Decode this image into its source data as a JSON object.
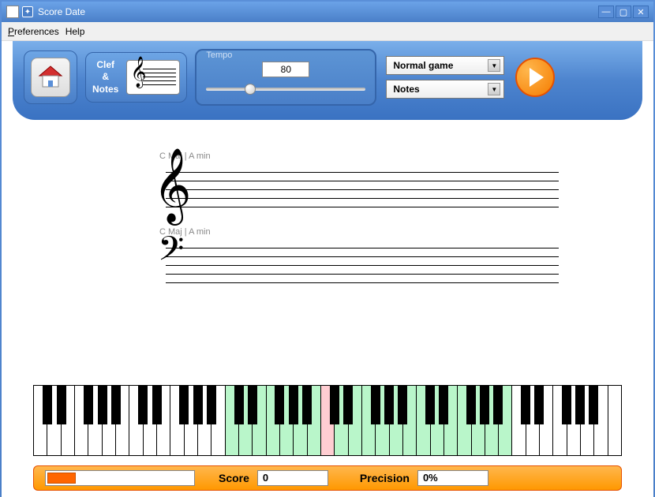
{
  "window": {
    "title": "Score Date"
  },
  "menubar": {
    "preferences": "Preferences",
    "help": "Help"
  },
  "toolbar": {
    "clef_notes_line1": "Clef",
    "clef_notes_line2": "&",
    "clef_notes_line3": "Notes",
    "tempo_label": "Tempo",
    "tempo_value": "80",
    "game_mode": "Normal game",
    "notes_mode": "Notes"
  },
  "staff": {
    "key1": "C Maj | A min",
    "key2": "C Maj | A min"
  },
  "keyboard": {
    "white_key_colors": [
      "w",
      "w",
      "w",
      "w",
      "w",
      "w",
      "w",
      "w",
      "w",
      "w",
      "w",
      "w",
      "w",
      "w",
      "g",
      "g",
      "g",
      "g",
      "g",
      "g",
      "g",
      "p",
      "g",
      "g",
      "g",
      "g",
      "g",
      "g",
      "g",
      "g",
      "g",
      "g",
      "g",
      "g",
      "g",
      "w",
      "w",
      "w",
      "w",
      "w",
      "w",
      "w",
      "w"
    ],
    "black_key_pattern": [
      1,
      1,
      0,
      1,
      1,
      1,
      0
    ]
  },
  "status": {
    "score_label": "Score",
    "score_value": "0",
    "precision_label": "Precision",
    "precision_value": "0%"
  }
}
